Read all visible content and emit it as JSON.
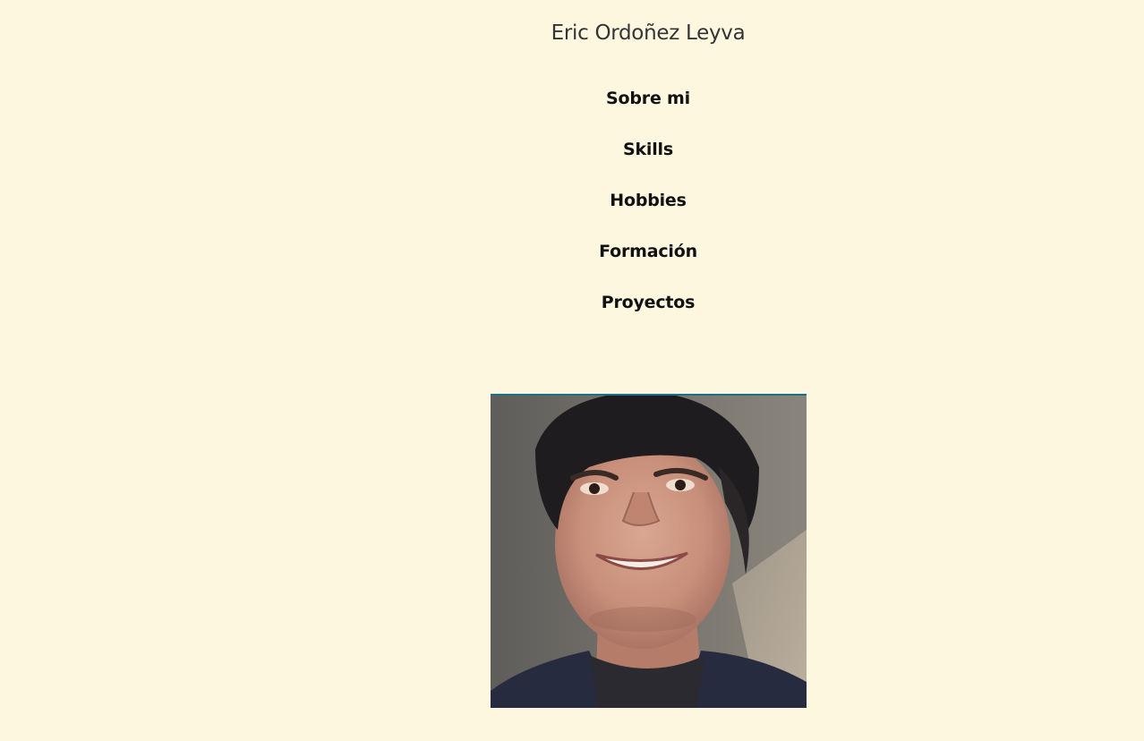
{
  "header": {
    "site_name": "Eric Ordoñez Leyva"
  },
  "nav": {
    "items": [
      {
        "label": "Sobre mi"
      },
      {
        "label": "Skills"
      },
      {
        "label": "Hobbies"
      },
      {
        "label": "Formación"
      },
      {
        "label": "Proyectos"
      }
    ]
  },
  "profile_photo": {
    "accent_border_color": "#1e6f8a"
  },
  "colors": {
    "background": "#fdf7df",
    "title_text": "#343434",
    "nav_text": "#111111"
  }
}
